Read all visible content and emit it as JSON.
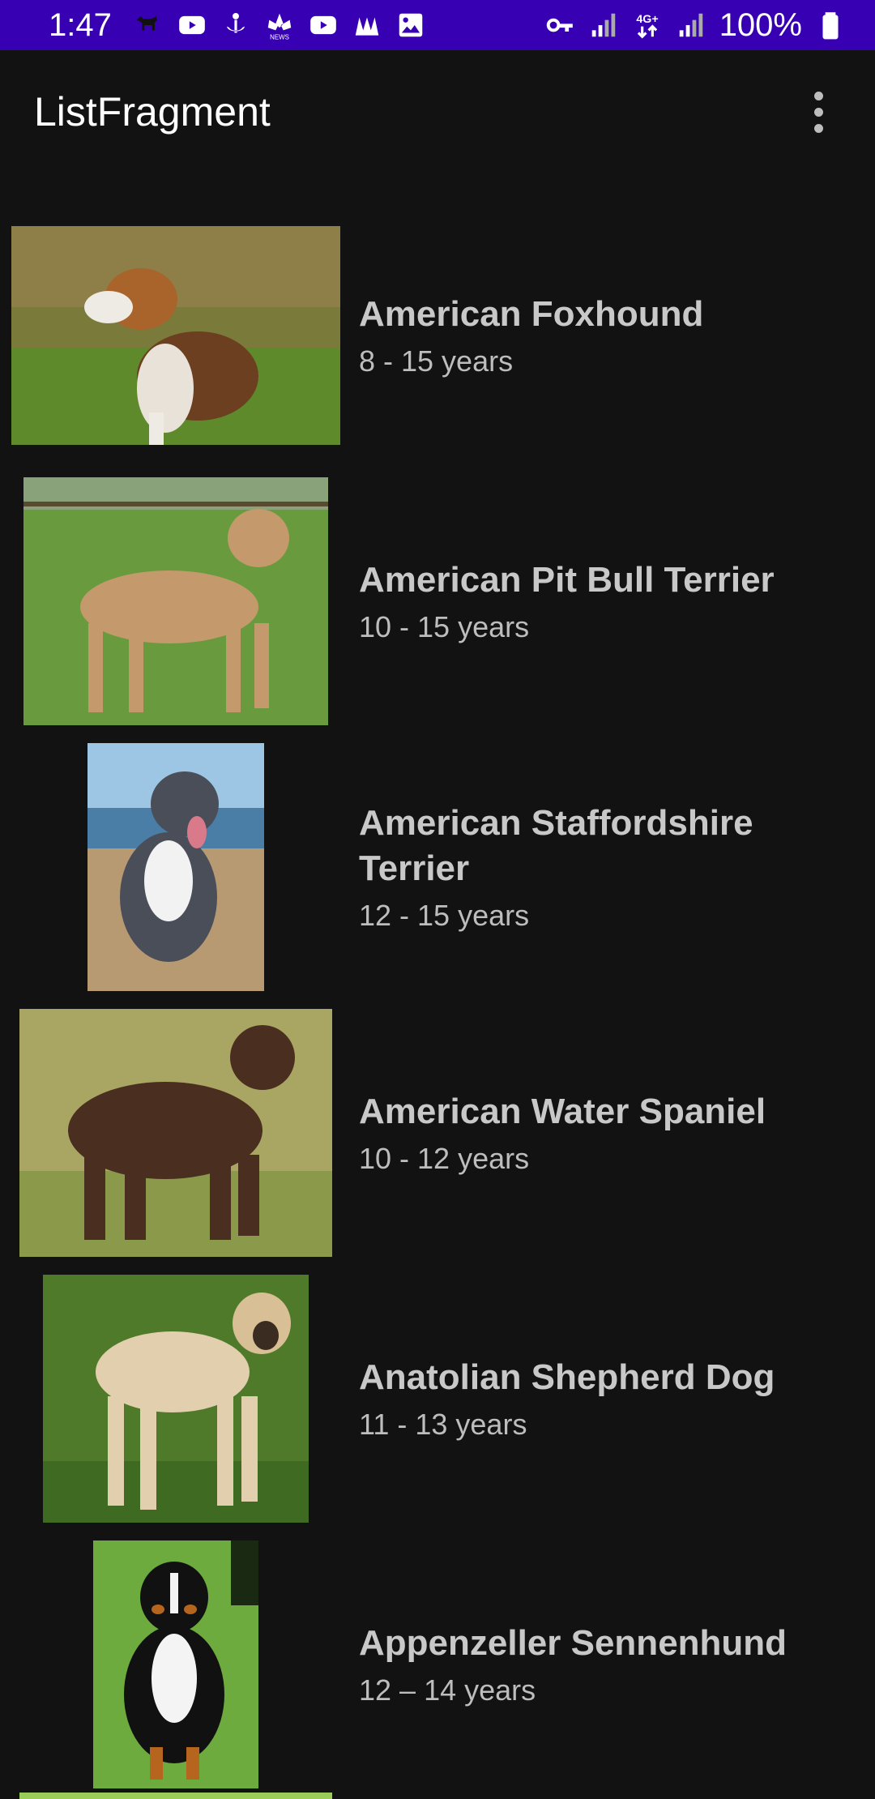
{
  "status_bar": {
    "time": "1:47",
    "battery": "100%",
    "left_icons": [
      "dog-icon",
      "youtube-icon",
      "anchor-icon",
      "news-icon",
      "youtube-icon",
      "chart-icon",
      "image-icon"
    ],
    "right_icons": [
      "key-icon",
      "signal-icon",
      "data-4g-icon",
      "signal-icon",
      "battery-icon"
    ]
  },
  "app_bar": {
    "title": "ListFragment",
    "menu_icon": "more-vert-icon"
  },
  "breeds": [
    {
      "name": "American Foxhound",
      "life": "8 - 15 years"
    },
    {
      "name": "American Pit Bull Terrier",
      "life": "10 - 15 years"
    },
    {
      "name": "American Staffordshire Terrier",
      "life": "12 - 15 years"
    },
    {
      "name": "American Water Spaniel",
      "life": "10 - 12 years"
    },
    {
      "name": "Anatolian Shepherd Dog",
      "life": "11 - 13 years"
    },
    {
      "name": "Appenzeller Sennenhund",
      "life": "12 – 14 years"
    }
  ],
  "colors": {
    "status_bar": "#3700b3",
    "background": "#121212",
    "title_text": "#c8c8c8",
    "subtitle_text": "#bdbdbd"
  }
}
